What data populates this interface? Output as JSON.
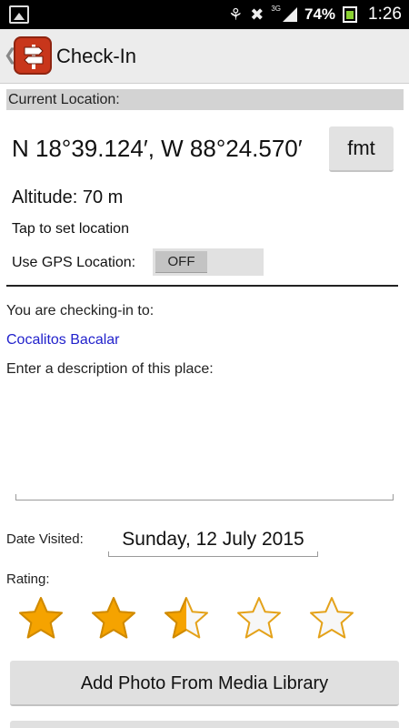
{
  "status_bar": {
    "network": "3G",
    "battery_percent": "74%",
    "time": "1:26",
    "icons": [
      "gallery-icon",
      "bug-icon",
      "data-transfer-icon",
      "signal-icon",
      "battery-icon"
    ]
  },
  "action_bar": {
    "title": "Check-In",
    "back_icon": "chevron-left-icon",
    "app_icon": "signpost-icon"
  },
  "location": {
    "header": "Current Location:",
    "coordinates": "N 18°39.124′, W 88°24.570′",
    "format_button": "fmt",
    "altitude": "Altitude: 70 m",
    "tap_hint": "Tap to set location",
    "gps_label": "Use GPS Location:",
    "gps_toggle": "OFF"
  },
  "checkin": {
    "checking_label": "You are checking-in to:",
    "place_name": "Cocalitos Bacalar",
    "description_label": "Enter a description of this place:",
    "description_value": "",
    "date_label": "Date Visited:",
    "date_value": "Sunday, 12 July 2015",
    "rating_label": "Rating:",
    "rating": 2.5,
    "rating_max": 5
  },
  "buttons": {
    "add_photo": "Add Photo From Media Library"
  },
  "colors": {
    "link": "#2222cc",
    "star_fill": "#f5a300",
    "app_icon": "#c8361b",
    "toggle_off": "#c3c3c3"
  }
}
